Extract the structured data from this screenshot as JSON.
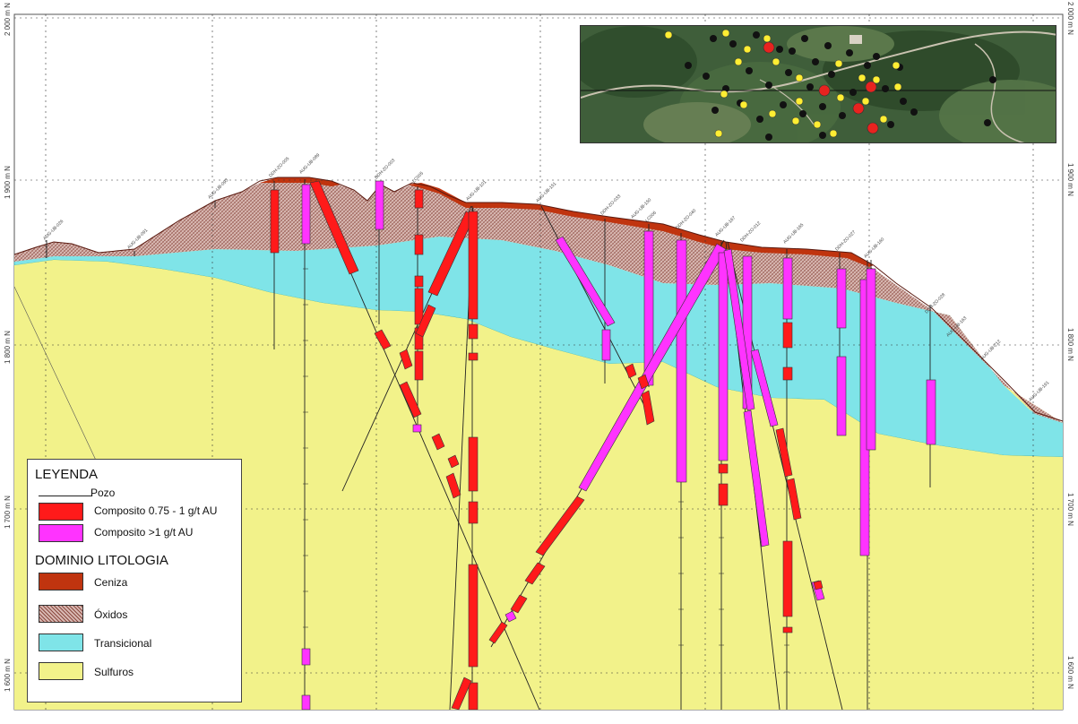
{
  "axis_labels": {
    "left": [
      "2 000 m N",
      "1 900 m N",
      "1 800 m N",
      "1 700 m N",
      "1 600 m N"
    ],
    "right": [
      "2 000 m N",
      "1 900 m N",
      "1 800 m N",
      "1 700 m N",
      "1 600 m N"
    ]
  },
  "hole_labels": [
    "AUG-UB-026",
    "AUG-UB-091",
    "AUG-UB-093",
    "DDH-ZO-005",
    "AUG-UB-089",
    "DDH-ZO-003",
    "LC005",
    "AUG-UB-101",
    "AUG-UB-151",
    "DDH-ZO-033",
    "AUG-UB-150",
    "LC006",
    "DDH-ZO-040",
    "AUG-UB-167",
    "DDH-ZO-012",
    "AUG-UB-165",
    "DDH-ZO-027",
    "AUG-UB-160",
    "DDH-ZO-028",
    "AUG-UB-163",
    "AUG-UB-212",
    "AUG-UB-191"
  ],
  "legend": {
    "title": "LEYENDA",
    "hole_label": "Pozo",
    "composite_low": "Composito 0.75 - 1 g/t AU",
    "composite_high": "Composito >1 g/t AU",
    "domain_title": "DOMINIO LITOLOGIA",
    "ash": "Ceniza",
    "oxides": "Óxidos",
    "transitional": "Transicional",
    "sulfides": "Sulfuros"
  },
  "colors": {
    "ash": "#c0340f",
    "oxides": "#c8a8a4",
    "transitional": "#7fe4e8",
    "sulfides": "#f2f28a",
    "composite_low": "#ff1a1a",
    "composite_high": "#ff33ff",
    "inset_red_marker": "#e8231f",
    "inset_yellow_marker": "#ffee33",
    "inset_black_marker": "#111111"
  }
}
